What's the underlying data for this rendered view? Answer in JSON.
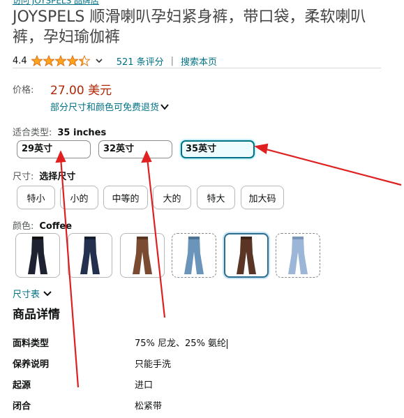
{
  "header": {
    "store_link": "访问 JOYSPELS 品牌店",
    "title": "JOYSPELS 顺滑喇叭孕妇紧身裤，带口袋，柔软喇叭裤，孕妇瑜伽裤"
  },
  "rating": {
    "value": "4.4",
    "stars_filled": 4.4,
    "reviews_label": "521 条评分",
    "separator": "|",
    "search_page_label": "搜索本页"
  },
  "price": {
    "label": "价格:",
    "value": "27.00 美元",
    "returns_label": "部分尺寸和颜色可免费退货"
  },
  "fit": {
    "label": "适合类型:",
    "selected": "35 inches",
    "options": [
      "29英寸",
      "32英寸",
      "35英寸"
    ]
  },
  "size": {
    "label": "尺寸:",
    "selected": "选择尺寸",
    "options": [
      "特小",
      "小的",
      "中等的",
      "大的",
      "特大",
      "加大码"
    ]
  },
  "color": {
    "label": "颜色:",
    "selected": "Coffee",
    "swatches": [
      "black-jeans",
      "navy-jeans",
      "brown-jeans",
      "light-blue-jeans",
      "coffee-jeans",
      "pale-blue-jeans"
    ]
  },
  "size_chart_label": "尺寸表",
  "details": {
    "title": "商品详情",
    "rows": [
      {
        "label": "面料类型",
        "value": "75% 尼龙、25% 氨纶"
      },
      {
        "label": "保养说明",
        "value": "只能手洗"
      },
      {
        "label": "起源",
        "value": "进口"
      },
      {
        "label": "闭合",
        "value": "松紧带"
      }
    ]
  },
  "colors": {
    "link": "#007185",
    "price": "#b12704",
    "star": "#ffa41c",
    "arrow": "#e02020",
    "selected_border": "#007185"
  }
}
